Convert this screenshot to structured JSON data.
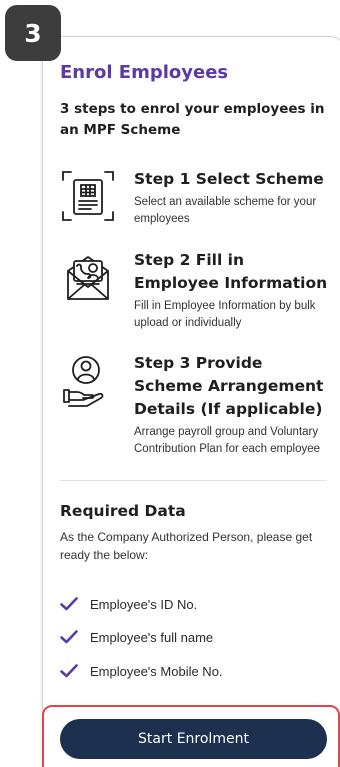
{
  "badge": {
    "number": "3"
  },
  "card": {
    "title": "Enrol Employees",
    "subtitle": "3 steps to enrol your employees in an MPF Scheme",
    "steps": [
      {
        "icon": "scheme-document-icon",
        "title": "Step 1 Select Scheme",
        "description": "Select an available scheme for your employees"
      },
      {
        "icon": "contact-envelope-icon",
        "title": "Step 2 Fill in Employee Information",
        "description": "Fill in Employee Information by bulk upload or individually"
      },
      {
        "icon": "person-hand-icon",
        "title": "Step 3 Provide Scheme Arrangement Details (If applicable)",
        "description": "Arrange payroll group and Voluntary Contribution Plan for each employee"
      }
    ],
    "required": {
      "title": "Required Data",
      "description": "As the Company Authorized Person, please get ready the below:",
      "items": [
        {
          "icon": "checkmark-icon",
          "label": "Employee's ID No."
        },
        {
          "icon": "checkmark-icon",
          "label": "Employee's full name"
        },
        {
          "icon": "checkmark-icon",
          "label": "Employee's Mobile No."
        }
      ]
    },
    "cta": {
      "label": "Start Enrolment"
    }
  },
  "colors": {
    "accent": "#5b3aa8",
    "button": "#1d3050",
    "highlight": "#e0474c",
    "badge": "#3d3d3d"
  }
}
